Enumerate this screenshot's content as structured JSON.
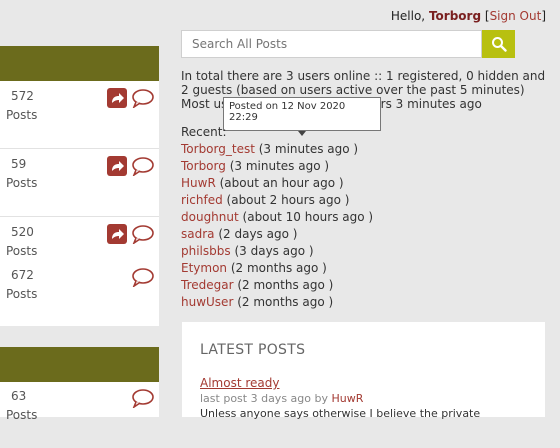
{
  "header": {
    "greeting": "Hello,",
    "user": "Torborg",
    "signout": "Sign Out"
  },
  "search": {
    "placeholder": "Search All Posts"
  },
  "online": {
    "text": "In total there are 3 users online :: 1 registered, 0 hidden and 2 guests (based on users active over the past 5 minutes) Most users ever online was 3 users 3 minutes ago"
  },
  "tooltip": {
    "text": "Posted on 12 Nov 2020 22:29"
  },
  "recent": {
    "label": "Recent:",
    "items": [
      {
        "name": "Torborg_test",
        "time": "(3 minutes ago )"
      },
      {
        "name": "Torborg",
        "time": "(3 minutes ago )"
      },
      {
        "name": "HuwR",
        "time": "(about an hour ago )"
      },
      {
        "name": "richfed",
        "time": "(about 2 hours ago )"
      },
      {
        "name": "doughnut",
        "time": "(about 10 hours ago )"
      },
      {
        "name": "sadra",
        "time": "(2 days ago )"
      },
      {
        "name": "philsbbs",
        "time": "(3 days ago )"
      },
      {
        "name": "Etymon",
        "time": "(2 months ago )"
      },
      {
        "name": "Tredegar",
        "time": "(2 months ago )"
      },
      {
        "name": "huwUser",
        "time": "(2 months ago )"
      }
    ]
  },
  "forums": [
    {
      "count": "572",
      "posts": "Posts"
    },
    {
      "count": "59",
      "posts": "Posts"
    },
    {
      "count": "520",
      "posts": "Posts"
    },
    {
      "count": "672",
      "posts": "Posts"
    },
    {
      "count": "63",
      "posts": "Posts"
    }
  ],
  "latest": {
    "title": "LATEST POSTS",
    "post_title": "Almost ready",
    "meta": "last post 3 days ago  by",
    "meta_user": "HuwR",
    "snippet": "Unless anyone says otherwise I believe the private"
  }
}
